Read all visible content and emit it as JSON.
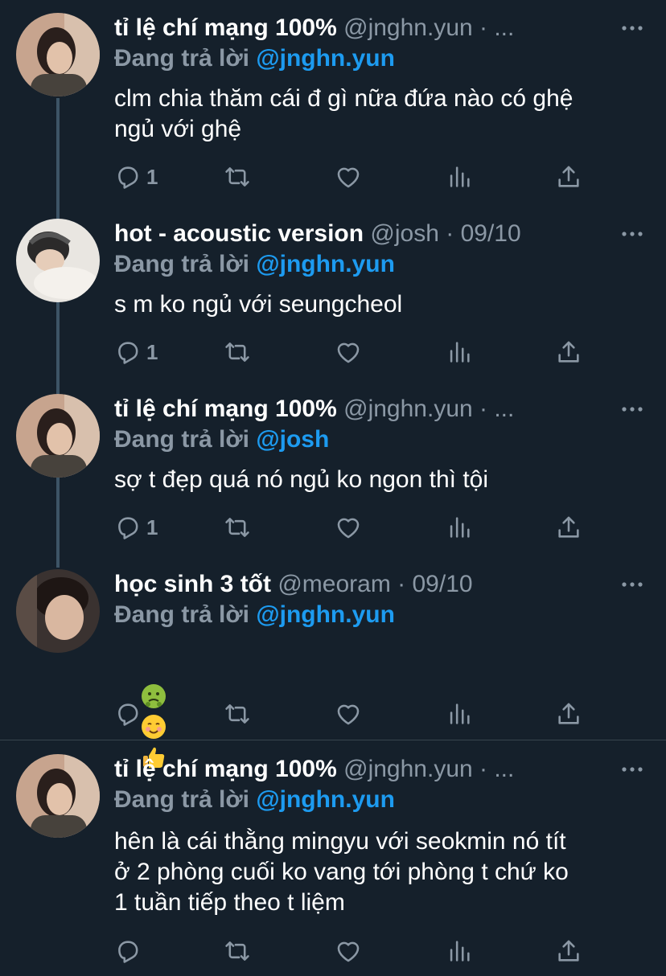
{
  "tweets": [
    {
      "name": "tỉ lệ chí mạng 100%",
      "handle": "@jnghn.yun",
      "meta_suffix": " · ...",
      "replying_label": "Đang trả lời ",
      "replying_to": "@jnghn.yun",
      "text": "clm chia thăm cái đ gì nữa đứa nào có ghệ\nngủ với ghệ",
      "reply_count": "1"
    },
    {
      "name": "hot - acoustic version",
      "handle": "@josh",
      "meta_suffix": " · 09/10",
      "replying_label": "Đang trả lời ",
      "replying_to": "@jnghn.yun",
      "text": "s m ko ngủ với seungcheol",
      "reply_count": "1"
    },
    {
      "name": "tỉ lệ chí mạng 100%",
      "handle": "@jnghn.yun",
      "meta_suffix": " · ...",
      "replying_label": "Đang trả lời ",
      "replying_to": "@josh",
      "text": "sợ t đẹp quá nó ngủ ko ngon thì tội",
      "reply_count": "1"
    },
    {
      "name": "học sinh 3 tốt",
      "handle": "@meoram",
      "meta_suffix": " · 09/10",
      "replying_label": "Đang trả lời ",
      "replying_to": "@jnghn.yun",
      "text": "",
      "emojis": [
        "nauseated-face-emoji",
        "smiling-face-emoji",
        "thumbs-up-emoji"
      ],
      "reply_count": ""
    },
    {
      "name": "tỉ lệ chí mạng 100%",
      "handle": "@jnghn.yun",
      "meta_suffix": " · ...",
      "replying_label": "Đang trả lời ",
      "replying_to": "@jnghn.yun",
      "text": "hên là cái thằng mingyu với seokmin nó tít\nở 2 phòng cuối ko vang tới phòng t chứ ko\n1 tuần tiếp theo t liệm",
      "reply_count": ""
    }
  ],
  "icons": [
    "reply-icon",
    "retweet-icon",
    "like-icon",
    "analytics-icon",
    "share-icon",
    "more-icon"
  ],
  "colors": {
    "background": "#15202b",
    "secondary_text": "#8b98a5",
    "mention": "#1d9bf0",
    "thread_line": "#3d5466",
    "divider": "#38444d"
  }
}
